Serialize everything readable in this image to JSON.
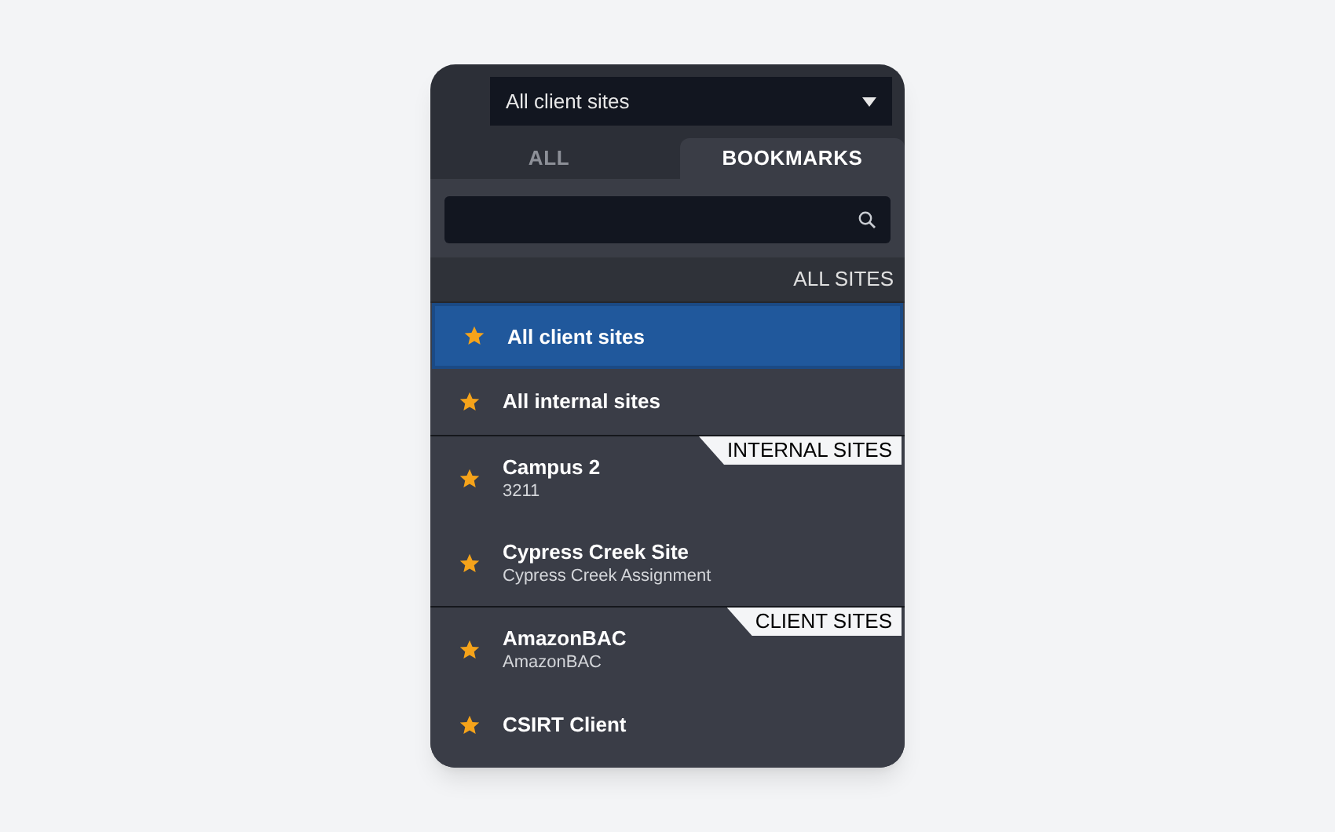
{
  "site_select": {
    "value": "All client sites"
  },
  "tabs": [
    {
      "label": "ALL",
      "selected": false
    },
    {
      "label": "BOOKMARKS",
      "selected": true
    }
  ],
  "groups": [
    {
      "kind": "header",
      "label": "ALL SITES",
      "items": [
        {
          "name": "All client sites",
          "selected": true
        },
        {
          "name": "All internal sites",
          "selected": false
        }
      ]
    },
    {
      "kind": "tag",
      "label": "INTERNAL SITES",
      "items": [
        {
          "name": "Campus 2",
          "subtitle": "3211",
          "selected": false
        },
        {
          "name": "Cypress Creek Site",
          "subtitle": "Cypress Creek Assignment",
          "selected": false
        }
      ]
    },
    {
      "kind": "tag",
      "label": "CLIENT SITES",
      "items": [
        {
          "name": "AmazonBAC",
          "subtitle": "AmazonBAC",
          "selected": false
        },
        {
          "name": "CSIRT Client",
          "selected": false
        }
      ]
    }
  ]
}
